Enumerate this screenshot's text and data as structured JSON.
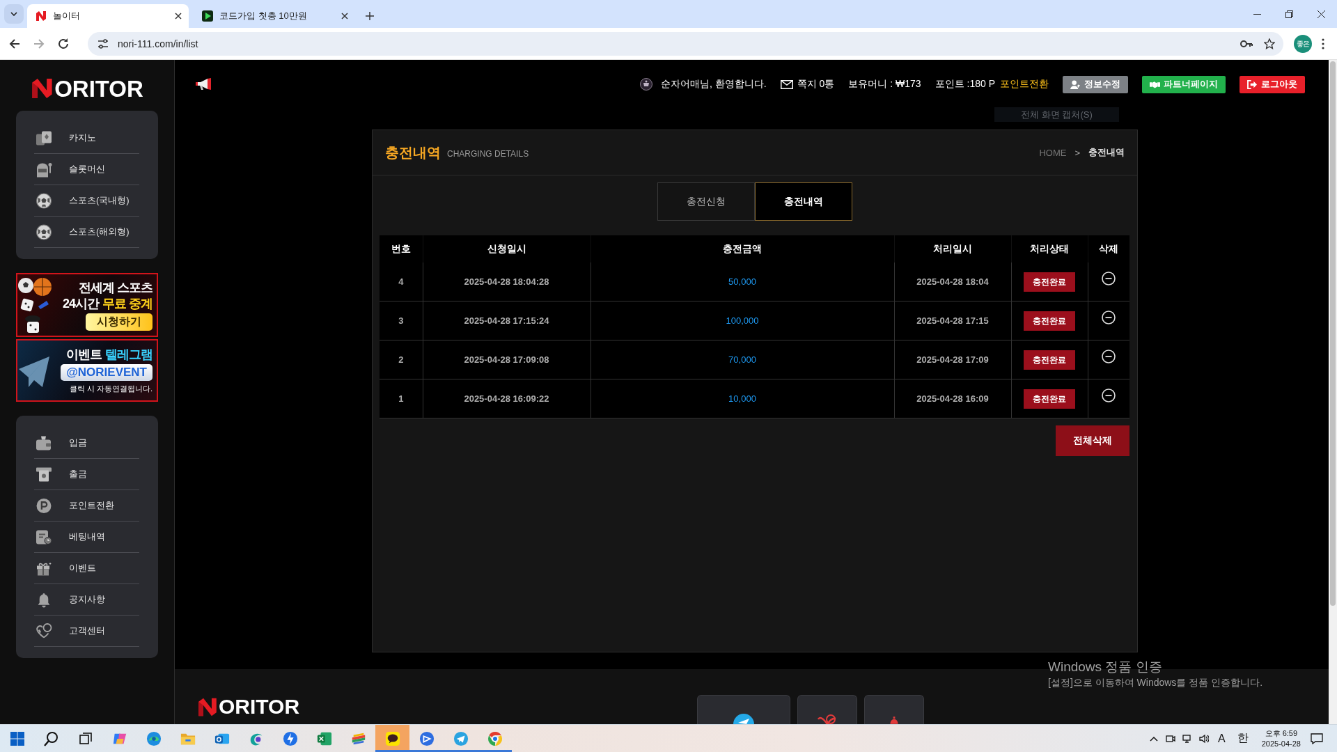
{
  "browser": {
    "tabs": [
      {
        "title": "놀이터",
        "kind": "nlogo",
        "selected": true
      },
      {
        "title": "코드가입 첫충 10만원",
        "kind": "play",
        "selected": false
      }
    ],
    "url": "nori-111.com/in/list",
    "profile": "좋은"
  },
  "sidebar": {
    "logo": "ORITOR",
    "games": [
      {
        "label": "카지노",
        "kind": "cards"
      },
      {
        "label": "슬롯머신",
        "kind": "slot"
      },
      {
        "label": "스포츠(국내형)",
        "kind": "ball"
      },
      {
        "label": "스포츠(해외형)",
        "kind": "ball"
      }
    ],
    "banners": [
      {
        "kind": "sports",
        "lines": [
          [
            {
              "text": "전세계 스포츠",
              "highlight": false
            }
          ],
          [
            {
              "text": "24시간",
              "highlight": false
            },
            {
              "text": "무료 중계",
              "highlight": true
            }
          ]
        ],
        "button": "시청하기"
      },
      {
        "kind": "telegram",
        "lines": [
          [
            {
              "text": "이벤트",
              "highlight": false
            },
            {
              "text": "텔레그램",
              "highlight": true
            }
          ]
        ],
        "button": "@NORIEVENT",
        "note": "클릭 시 자동연결됩니다."
      }
    ],
    "account": [
      {
        "label": "입금",
        "kind": "wallet"
      },
      {
        "label": "출금",
        "kind": "atm"
      },
      {
        "label": "포인트전환",
        "kind": "coin"
      },
      {
        "label": "베팅내역",
        "kind": "receipt"
      },
      {
        "label": "이벤트",
        "kind": "gift"
      },
      {
        "label": "공지사항",
        "kind": "bell"
      },
      {
        "label": "고객센터",
        "kind": "support"
      }
    ]
  },
  "header": {
    "welcome": "순자어매님, 환영합니다.",
    "messages": "쪽지 0통",
    "money": "보유머니 : ₩173",
    "points": "포인트 :180 P",
    "point_link": "포인트전환",
    "buttons": [
      {
        "label": "정보수정",
        "kind": "profile"
      },
      {
        "label": "파트너페이지",
        "kind": "partner"
      },
      {
        "label": "로그아웃",
        "kind": "logout"
      }
    ],
    "tooltip": "전체 화면 캡처(S)"
  },
  "panel": {
    "title": "충전내역",
    "subtitle": "CHARGING DETAILS",
    "breadcrumb": {
      "home": "HOME",
      "separator": ">",
      "current": "충전내역"
    },
    "tabs": [
      {
        "label": "충전신청",
        "selected": false
      },
      {
        "label": "충전내역",
        "selected": true
      }
    ],
    "table": {
      "columns": [
        "번호",
        "신청일시",
        "충전금액",
        "처리일시",
        "처리상태",
        "삭제"
      ],
      "rows": [
        {
          "no": "4",
          "requested": "2025-04-28 18:04:28",
          "amount": "50,000",
          "processed": "2025-04-28 18:04",
          "status": "충전완료"
        },
        {
          "no": "3",
          "requested": "2025-04-28 17:15:24",
          "amount": "100,000",
          "processed": "2025-04-28 17:15",
          "status": "충전완료"
        },
        {
          "no": "2",
          "requested": "2025-04-28 17:09:08",
          "amount": "70,000",
          "processed": "2025-04-28 17:09",
          "status": "충전완료"
        },
        {
          "no": "1",
          "requested": "2025-04-28 16:09:22",
          "amount": "10,000",
          "processed": "2025-04-28 16:09",
          "status": "충전완료"
        }
      ]
    },
    "delete_all": "전체삭제"
  },
  "footer": {
    "logo": "ORITOR",
    "tiles": [
      {
        "kind": "telegram"
      },
      {
        "kind": "support"
      },
      {
        "kind": "bell"
      }
    ]
  },
  "activation": {
    "title": "Windows 정품 인증",
    "text": "[설정]으로 이동하여 Windows를 정품 인증합니다."
  },
  "taskbar": {
    "apps": [
      {
        "kind": "copilot",
        "running": false,
        "flashing": false
      },
      {
        "kind": "edge",
        "running": false,
        "flashing": false
      },
      {
        "kind": "folder",
        "running": false,
        "flashing": false
      },
      {
        "kind": "mail",
        "running": false,
        "flashing": false
      },
      {
        "kind": "swirl",
        "running": false,
        "flashing": false
      },
      {
        "kind": "bolt",
        "running": false,
        "flashing": false
      },
      {
        "kind": "sheet",
        "running": false,
        "flashing": false
      },
      {
        "kind": "palette",
        "running": false,
        "flashing": false
      },
      {
        "kind": "chat",
        "running": true,
        "flashing": true
      },
      {
        "kind": "remote",
        "running": true,
        "flashing": false
      },
      {
        "kind": "plane",
        "running": true,
        "flashing": false
      },
      {
        "kind": "chrome",
        "running": true,
        "flashing": false
      }
    ],
    "tray": {
      "input": "A",
      "ime": "한",
      "time": "오후 6:59",
      "date": "2025-04-28"
    }
  }
}
